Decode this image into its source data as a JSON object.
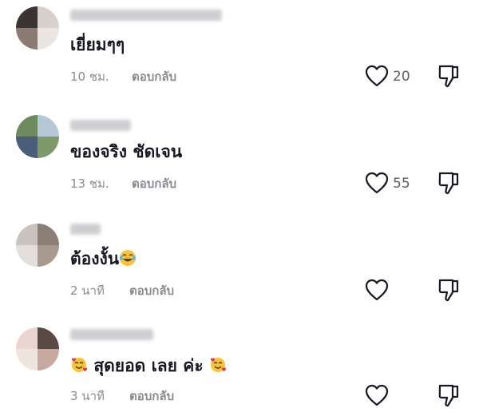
{
  "comments": [
    {
      "text": "เยี่ยมๆๆ",
      "time": "10 ชม.",
      "reply_label": "ตอบกลับ",
      "like_count": "20",
      "has_emoji": false,
      "avatar_colors": [
        "#3a3433",
        "#d8d0cc",
        "#8c7b74",
        "#ece6e2"
      ]
    },
    {
      "text": "ของจริง ชัดเจน",
      "time": "13 ชม.",
      "reply_label": "ตอบกลับ",
      "like_count": "55",
      "has_emoji": false,
      "avatar_colors": [
        "#6d8a5e",
        "#b6c7d8",
        "#4a5d7a",
        "#7e9a6a"
      ]
    },
    {
      "text": "ต้องงั้น",
      "time": "2 นาที",
      "reply_label": "ตอบกลับ",
      "like_count": "",
      "has_emoji": true,
      "emoji_name": "laughing-tears-emoji",
      "avatar_colors": [
        "#c9c3bd",
        "#8a7e75",
        "#e4dfda",
        "#a89a8f"
      ]
    },
    {
      "text_before": "",
      "text": "สุดยอด เลย ค่ะ",
      "time": "3 นาที",
      "reply_label": "ตอบกลับ",
      "like_count": "",
      "has_emoji": true,
      "emoji_name": "smiling-face-with-hearts-emoji",
      "avatar_colors": [
        "#e9d6d0",
        "#5a4a45",
        "#f0e4df",
        "#c7a89e"
      ]
    }
  ],
  "icons": {
    "like": "heart-outline-icon",
    "dislike": "thumbs-down-outline-icon"
  },
  "colors": {
    "text": "#161823",
    "secondary": "#8a8b91",
    "icon": "#161823",
    "username_blur": "#c2c3c7"
  }
}
